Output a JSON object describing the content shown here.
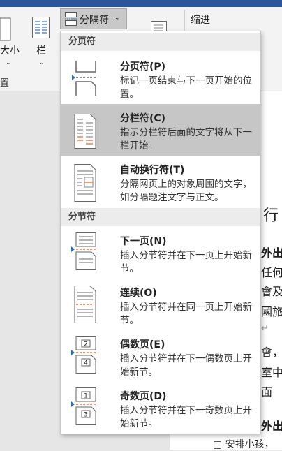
{
  "ribbon": {
    "breaks_button_label": "分隔符",
    "size_label": "大小",
    "columns_label": "栏",
    "indent_label": "缩进"
  },
  "menu": {
    "sections": [
      {
        "header": "分页符",
        "items": [
          {
            "title": "分页符(P)",
            "desc": "标记一页结束与下一页开始的位置。",
            "icon": "page-break-icon"
          },
          {
            "title": "分栏符(C)",
            "desc": "指示分栏符后面的文字将从下一栏开始。",
            "icon": "column-break-icon",
            "highlighted": true
          },
          {
            "title": "自动换行符(T)",
            "desc": "分隔网页上的对象周围的文字，如分隔题注文字与正文。",
            "icon": "text-wrapping-break-icon"
          }
        ]
      },
      {
        "header": "分节符",
        "items": [
          {
            "title": "下一页(N)",
            "desc": "插入分节符并在下一页上开始新节。",
            "icon": "next-page-section-icon"
          },
          {
            "title": "连续(O)",
            "desc": "插入分节符并在同一页上开始新节。",
            "icon": "continuous-section-icon"
          },
          {
            "title": "偶数页(E)",
            "desc": "插入分节符并在下一偶数页上开始新节。",
            "icon": "even-page-section-icon",
            "page_numbers": [
              "2",
              "4"
            ]
          },
          {
            "title": "奇数页(D)",
            "desc": "插入分节符并在下一奇数页上开始新节。",
            "icon": "odd-page-section-icon",
            "page_numbers": [
              "1",
              "3"
            ]
          }
        ]
      }
    ]
  },
  "document": {
    "heading_fragment": "行",
    "lines": [
      "外出",
      "任何",
      "會及",
      "國旅",
      "↵",
      "會，",
      "室中",
      "面",
      "外出",
      "□ 安排小孩，"
    ]
  },
  "colors": {
    "brand_blue": "#2b579a",
    "highlight": "#c6c6c6",
    "icon_blue": "#2e75b6",
    "icon_orange": "#e8743b"
  }
}
